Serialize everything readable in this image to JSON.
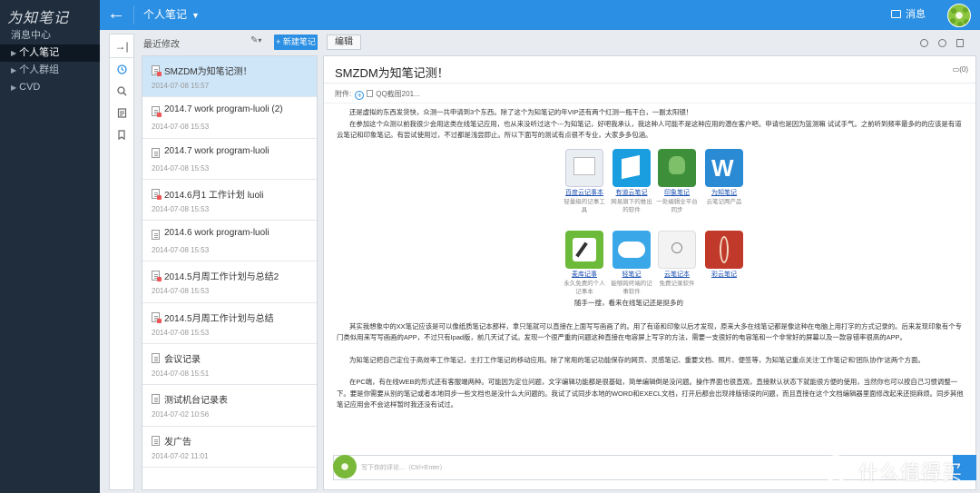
{
  "app": {
    "logo": "为知笔记"
  },
  "sidebar": {
    "items": [
      {
        "label": "消息中心",
        "active": false
      },
      {
        "label": "个人笔记",
        "active": true
      },
      {
        "label": "个人群组",
        "active": false
      },
      {
        "label": "CVD",
        "active": false
      }
    ]
  },
  "topbar": {
    "back_icon": "arrow-left-icon",
    "notebook": "个人笔记",
    "messages": "消息",
    "accent": "#2b8fe3"
  },
  "toolstrip": {
    "icons": [
      "collapse-icon",
      "clock-icon",
      "search-icon",
      "note-icon",
      "tag-icon"
    ]
  },
  "notelist": {
    "title": "最近修改",
    "new_button": "+ 新建笔记",
    "items": [
      {
        "title": "SMZDM为知笔记测！",
        "date": "2014-07-08 15:57",
        "selected": true,
        "type": "img"
      },
      {
        "title": "2014.7 work program-luoli (2)",
        "date": "2014-07-08 15:53",
        "type": "img"
      },
      {
        "title": "2014.7 work program-luoli",
        "date": "2014-07-08 15:53",
        "type": "doc"
      },
      {
        "title": "2014.6月1 工作计划 luoli",
        "date": "2014-07-08 15:53",
        "type": "img"
      },
      {
        "title": "2014.6 work program-luoli",
        "date": "2014-07-08 15:53",
        "type": "doc"
      },
      {
        "title": "2014.5月周工作计划与总结2",
        "date": "2014-07-08 15:53",
        "type": "img"
      },
      {
        "title": "2014.5月周工作计划与总结",
        "date": "2014-07-08 15:53",
        "type": "img"
      },
      {
        "title": "会议记录",
        "date": "2014-07-08 15:51",
        "type": "doc"
      },
      {
        "title": "测试机台记录表",
        "date": "2014-07-02 10:56",
        "type": "doc"
      },
      {
        "title": "发广告",
        "date": "2014-07-02 11:01",
        "type": "doc"
      }
    ]
  },
  "editor": {
    "tab": "编辑",
    "note_title": "SMZDM为知笔记测！",
    "comments": "(0)",
    "attach_label": "附件:",
    "attach_file": "QQ截图201...",
    "para1": "还是虚拟的东西发货快，众测一共申请到3个东西。除了这个为知笔记的年VIP还有两个红测一瓶干白，一副太阳镜！",
    "para2": "在参加这个众测以前我很少会用这类在线笔记应用，也从来没听过这个---为知笔记，好吧我承认，我这种人可能不是这种应用的潜在客户吧。申请也是因为篮测嘛 试试手气。之前听到频率最多的的应该是有道云笔记和印象笔记。有尝试使用过，不过都是浅尝即止。所以下面写的测试有点很不专业，大家多多包涵。",
    "apps": [
      {
        "name": "百度云记事本",
        "desc": "轻量级的记事工具",
        "color": "#e8eef4",
        "icon": "baidu-note-icon"
      },
      {
        "name": "有道云笔记",
        "desc": "网易旗下的推出的软件",
        "color": "#1a9ee0",
        "icon": "youdao-note-icon"
      },
      {
        "name": "印象笔记",
        "desc": "一处编辑全平台同步",
        "color": "#3d8f3a",
        "icon": "evernote-icon"
      },
      {
        "name": "为知笔记",
        "desc": "云笔记两产品",
        "color": "#2a8ad4",
        "icon": "wiz-note-icon"
      },
      {
        "name": "麦库记事",
        "desc": "永久免费的个人记事本",
        "color": "#6cba3a",
        "icon": "maiku-note-icon"
      },
      {
        "name": "轻笔记",
        "desc": "能够跨终端的记事软件",
        "color": "#3aa7e8",
        "icon": "light-note-icon"
      },
      {
        "name": "云笔记本",
        "desc": "免费记录软件",
        "color": "#f3f3f3",
        "icon": "cloud-notebook-icon"
      },
      {
        "name": "彩云笔记",
        "desc": "",
        "color": "#c0392b",
        "icon": "caiyun-note-icon"
      }
    ],
    "caption": "随手一搜，看来在线笔记还是挺多的",
    "para3": "其实我想象中的XX笔记应该是可以像纸质笔记本那样，拿只笔就可以直接在上面写写画画了的。用了有道和印象以后才发现，原来大多在线笔记都是像这种在电脑上用打字的方式记录的。后来发现印象有个专门类似用来写写画画的APP，不过只有Ipad版，前几天试了试。发现一个很严重的问题这种直接在电容屏上写字的方法，需要一支很好的电容笔和一个非常好的屏幕以及一款容错率很高的APP。",
    "para4": "为知笔记把自己定位于高效率工作笔记，主打工作笔记的移动应用。除了常用的笔记功能保存的网页、灵感笔记、重要文档、照片、便签等，为知笔记重点关注'工作笔记'和'团队协作'这两个方面。",
    "para5": "在PC端，有在线WEB的形式还有客服端两种。可能因为定位问题，文字编辑功能都是很基础，简单编辑倒是没问题。操作界面也很直观，直接默认状态下就能很方便的使用，当然你也可以按自己习惯调整一下。要是你需要从别的笔记或者本地同步一些文档也是没什么大问题的。我试了试同步本地的WORD和EXECL文档，打开后都会出现排版错误的问题，而且直接在这个文档编辑器里面修改起来还挺麻烦。同步其他笔记应用会不会这样暂时我还没有试过。",
    "comment_placeholder": "写下你的评论...（Ctrl+Enter）"
  },
  "watermark": {
    "text": "什么值得买"
  }
}
